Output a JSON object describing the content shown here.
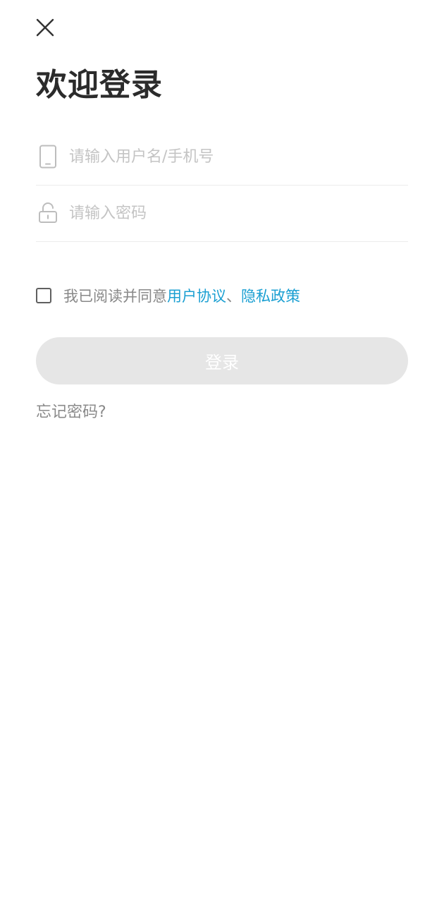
{
  "header": {
    "close_icon": "close-icon"
  },
  "title": "欢迎登录",
  "username": {
    "icon": "phone-icon",
    "placeholder": "请输入用户名/手机号",
    "value": ""
  },
  "password": {
    "icon": "lock-icon",
    "placeholder": "请输入密码",
    "value": ""
  },
  "agreement": {
    "checked": false,
    "prefix": "我已阅读并同意",
    "user_agreement": "用户协议",
    "separator": "、",
    "privacy_policy": "隐私政策"
  },
  "login_button": {
    "label": "登录",
    "enabled": false
  },
  "forgot_password": "忘记密码?",
  "colors": {
    "link": "#1a9fd2",
    "title": "#2b2b2b",
    "button_disabled": "#e6e6e6",
    "placeholder": "#c4c4c4"
  }
}
